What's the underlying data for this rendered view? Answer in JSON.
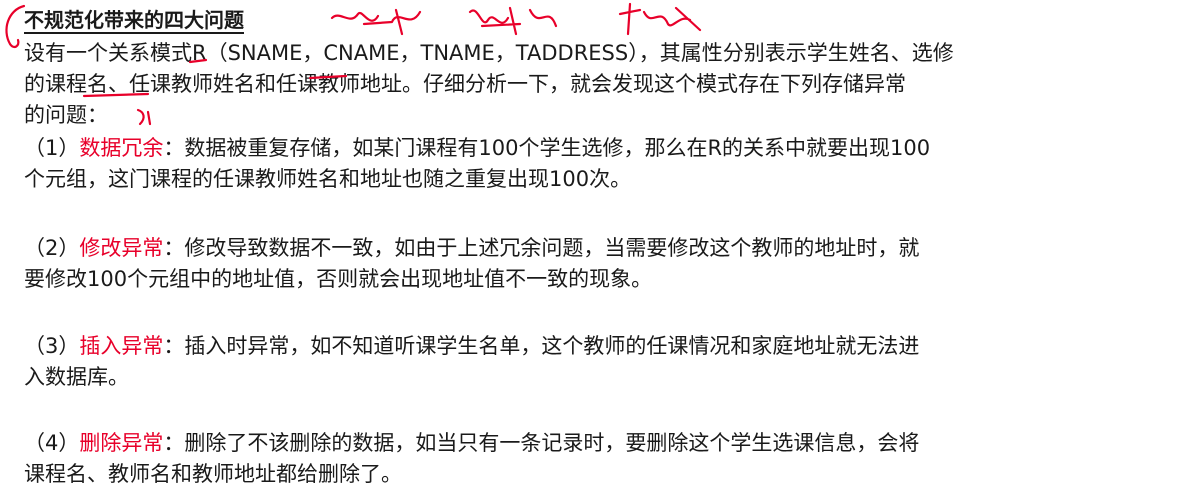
{
  "slide": {
    "title": "不规范化带来的四大问题",
    "intro_lines": [
      "设有一个关系模式R（SNAME，CNAME，TNAME，TADDRESS），其属性分别表示学生姓名、选修",
      "的课程名、任课教师姓名和任课教师地址。仔细分析一下，就会发现这个模式存在下列存储异常",
      "的问题："
    ],
    "items": [
      {
        "num": "（1）",
        "keyword": "数据冗余",
        "rest_first": "：数据被重复存储，如某门课程有100个学生选修，那么在R的关系中就要出现100",
        "line2": "个元组，这门课程的任课教师姓名和地址也随之重复出现100次。"
      },
      {
        "num": "（2）",
        "keyword": "修改异常",
        "rest_first": "：修改导致数据不一致，如由于上述冗余问题，当需要修改这个教师的地址时，就",
        "line2": "要修改100个元组中的地址值，否则就会出现地址值不一致的现象。"
      },
      {
        "num": "（3）",
        "keyword": "插入异常",
        "rest_first": "：插入时异常，如不知道听课学生名单，这个教师的任课情况和家庭地址就无法进",
        "line2": "入数据库。"
      },
      {
        "num": "（4）",
        "keyword": "删除异常",
        "rest_first": "：删除了不该删除的数据，如当只有一条记录时，要删除这个学生选课信息，会将",
        "line2": "课程名、教师名和教师地址都给删除了。"
      }
    ],
    "colors": {
      "keyword": "#e8002a",
      "ink": "#e8002a",
      "text": "#1a1a1a"
    }
  }
}
